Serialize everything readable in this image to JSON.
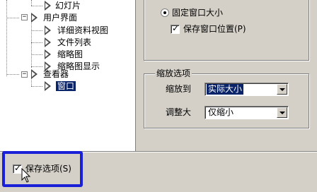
{
  "tree": {
    "items": [
      {
        "label": "幻灯片",
        "level": 2,
        "selected": false
      },
      {
        "label": "用户界面",
        "level": 1,
        "selected": false
      },
      {
        "label": "详细资料视图",
        "level": 2,
        "selected": false
      },
      {
        "label": "文件列表",
        "level": 2,
        "selected": false
      },
      {
        "label": "缩略图",
        "level": 2,
        "selected": false
      },
      {
        "label": "缩略图显示",
        "level": 2,
        "selected": false
      },
      {
        "label": "查看器",
        "level": 1,
        "selected": false
      },
      {
        "label": "窗口",
        "level": 2,
        "selected": true
      }
    ]
  },
  "window_group": {
    "fixed_size_label": "固定窗口大小",
    "fixed_size_selected": true,
    "save_position_label": "保存窗口位置(P)",
    "save_position_checked": true
  },
  "zoom_group": {
    "title": "缩放选项",
    "zoom_to_label": "缩放到",
    "zoom_to_value": "实际大小",
    "adjust_label": "调整大",
    "adjust_value": "仅缩小"
  },
  "footer": {
    "save_options_label": "保存选项(S)",
    "save_options_checked": true
  },
  "colors": {
    "highlight_border": "#1a20d8",
    "selection": "#0a246a",
    "dialog_bg": "#d4d0c8"
  }
}
